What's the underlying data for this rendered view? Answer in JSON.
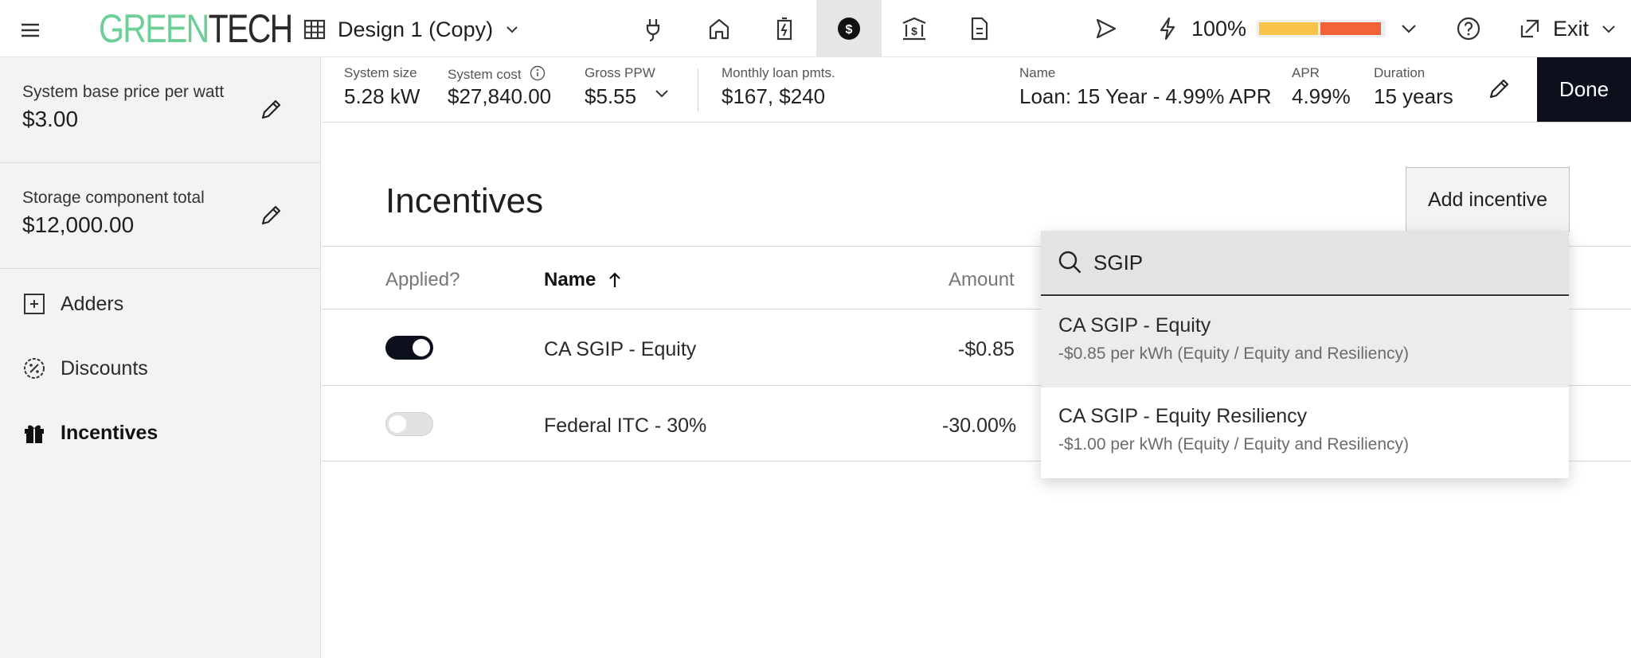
{
  "app": {
    "logo_green": "GREEN",
    "logo_dark": "TECH",
    "design_name": "Design 1 (Copy)",
    "completion": "100%",
    "completion_fraction": 1.0,
    "exit_label": "Exit",
    "colors": {
      "logo_green": "#6ccf98",
      "progress_yellow": "#f9c34a",
      "progress_red": "#f4623a",
      "done_bg": "#0c0f1c"
    }
  },
  "nav_icons": [
    "plug-icon",
    "home-icon",
    "battery-icon",
    "dollar-icon",
    "bank-icon",
    "document-icon"
  ],
  "sidebar": {
    "base_price": {
      "label": "System base price per watt",
      "value": "$3.00"
    },
    "storage": {
      "label": "Storage component total",
      "value": "$12,000.00"
    },
    "items": [
      {
        "label": "Adders",
        "icon": "plus-square-icon"
      },
      {
        "label": "Discounts",
        "icon": "discount-icon"
      },
      {
        "label": "Incentives",
        "icon": "gift-icon",
        "active": true
      }
    ]
  },
  "summary": {
    "system_size": {
      "label": "System size",
      "value": "5.28 kW"
    },
    "system_cost": {
      "label": "System cost",
      "value": "$27,840.00"
    },
    "gross_ppw": {
      "label": "Gross PPW",
      "value": "$5.55"
    },
    "monthly": {
      "label": "Monthly loan pmts.",
      "value": "$167, $240"
    },
    "name": {
      "label": "Name",
      "value": "Loan: 15 Year - 4.99% APR"
    },
    "apr": {
      "label": "APR",
      "value": "4.99%"
    },
    "duration": {
      "label": "Duration",
      "value": "15 years"
    },
    "done_label": "Done"
  },
  "main": {
    "title": "Incentives",
    "add_button": "Add incentive",
    "columns": {
      "applied": "Applied?",
      "name": "Name",
      "amount": "Amount"
    },
    "rows": [
      {
        "applied": true,
        "name": "CA SGIP - Equity",
        "amount": "-$0.85"
      },
      {
        "applied": false,
        "name": "Federal ITC - 30%",
        "amount": "-30.00%"
      }
    ]
  },
  "search": {
    "value": "SGIP",
    "options": [
      {
        "title": "CA SGIP - Equity",
        "subtitle": "-$0.85 per kWh (Equity / Equity and Resiliency)"
      },
      {
        "title": "CA SGIP - Equity Resiliency",
        "subtitle": "-$1.00 per kWh (Equity / Equity and Resiliency)"
      }
    ]
  }
}
